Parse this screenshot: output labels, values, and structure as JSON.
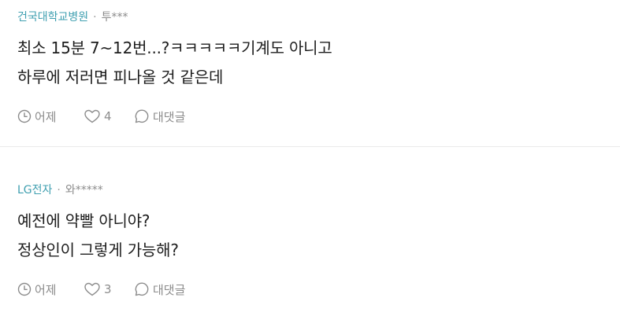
{
  "comments": [
    {
      "author_org": "건국대학교병원",
      "separator": "·",
      "author_id": "투***",
      "lines": [
        "최소 15분 7~12번...?ㅋㅋㅋㅋㅋ기계도 아니고",
        "하루에 저러면 피나올 것 같은데"
      ],
      "time": "어제",
      "likes": "4",
      "reply_label": "대댓글"
    },
    {
      "author_org": "LG전자",
      "separator": "·",
      "author_id": "와*****",
      "lines": [
        "예전에 약빨 아니야?",
        "정상인이 그렇게 가능해?"
      ],
      "time": "어제",
      "likes": "3",
      "reply_label": "대댓글"
    }
  ],
  "icons": {
    "time": "clock-icon",
    "like": "heart-icon",
    "reply": "speech-bubble-icon"
  },
  "colors": {
    "author_org": "#3f9fb0",
    "muted": "#8c8c8c",
    "divider": "#ebebeb"
  }
}
